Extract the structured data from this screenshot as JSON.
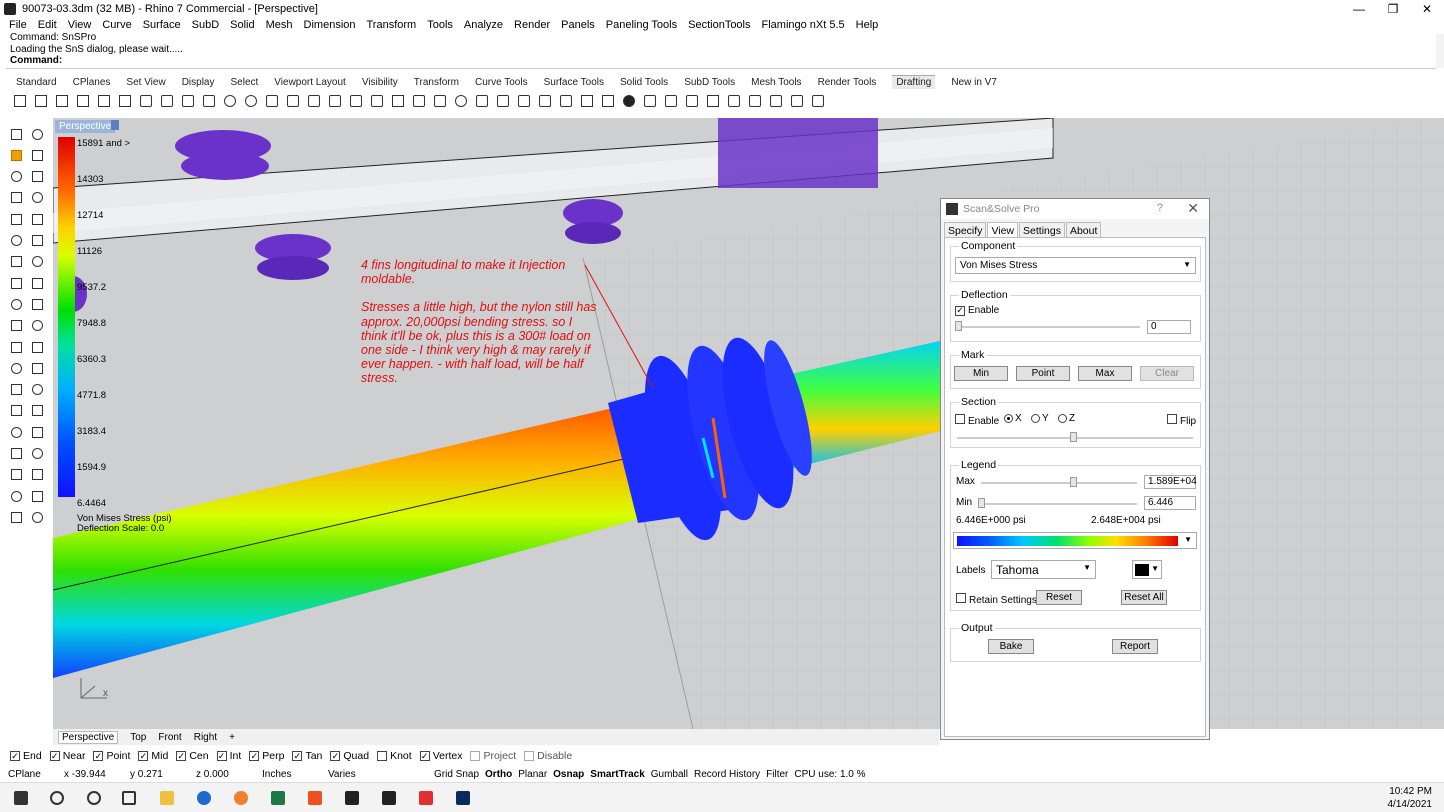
{
  "window": {
    "title": "90073-03.3dm (32 MB) - Rhino 7 Commercial - [Perspective]",
    "minimize": "—",
    "restore": "❐",
    "close": "✕"
  },
  "menu": [
    "File",
    "Edit",
    "View",
    "Curve",
    "Surface",
    "SubD",
    "Solid",
    "Mesh",
    "Dimension",
    "Transform",
    "Tools",
    "Analyze",
    "Render",
    "Panels",
    "Paneling Tools",
    "SectionTools",
    "Flamingo nXt 5.5",
    "Help"
  ],
  "command_history": {
    "line1": "Command: SnSPro",
    "line2": "Loading the SnS dialog, please wait.....",
    "prompt": "Command:"
  },
  "toolbar_tabs": [
    "Standard",
    "CPlanes",
    "Set View",
    "Display",
    "Select",
    "Viewport Layout",
    "Visibility",
    "Transform",
    "Curve Tools",
    "Surface Tools",
    "Solid Tools",
    "SubD Tools",
    "Mesh Tools",
    "Render Tools",
    "Drafting",
    "New in V7"
  ],
  "viewport": {
    "name": "Perspective",
    "legend_values": [
      "15891 and >",
      "14303",
      "12714",
      "11126",
      "9537.2",
      "7948.8",
      "6360.3",
      "4771.8",
      "3183.4",
      "1594.9",
      "6.4464"
    ],
    "legend_title": "Von Mises Stress (psi)",
    "deflection_scale": "Deflection Scale: 0.0",
    "annotation_p1": "4 fins longitudinal to make it Injection moldable.",
    "annotation_p2": "Stresses a little high, but the nylon still has approx. 20,000psi bending stress. so I think it'll be ok, plus this is a 300# load on one side - I think very high & may rarely if ever happen. - with half load, will be half stress.",
    "axis_label": "x"
  },
  "viewport_tabs": [
    "Perspective",
    "Top",
    "Front",
    "Right"
  ],
  "osnaps": [
    {
      "label": "End",
      "checked": true
    },
    {
      "label": "Near",
      "checked": true
    },
    {
      "label": "Point",
      "checked": true
    },
    {
      "label": "Mid",
      "checked": true
    },
    {
      "label": "Cen",
      "checked": true
    },
    {
      "label": "Int",
      "checked": true
    },
    {
      "label": "Perp",
      "checked": true
    },
    {
      "label": "Tan",
      "checked": true
    },
    {
      "label": "Quad",
      "checked": true
    },
    {
      "label": "Knot",
      "checked": false
    },
    {
      "label": "Vertex",
      "checked": true
    },
    {
      "label": "Project",
      "checked": false
    },
    {
      "label": "Disable",
      "checked": false
    }
  ],
  "status": {
    "cplane": "CPlane",
    "x": "x -39.944",
    "y": "y 0.271",
    "z": "z 0.000",
    "units": "Inches",
    "layer": "Varies",
    "grid_snap": "Grid Snap",
    "ortho": "Ortho",
    "planar": "Planar",
    "osnap": "Osnap",
    "smarttrack": "SmartTrack",
    "gumball": "Gumball",
    "record_history": "Record History",
    "filter": "Filter",
    "cpu": "CPU use: 1.0 %"
  },
  "panel": {
    "title": "Scan&Solve Pro",
    "help": "?",
    "close": "✕",
    "tabs": [
      "Specify",
      "View",
      "Settings",
      "About"
    ],
    "component_label": "Component",
    "component_value": "Von Mises Stress",
    "deflection_label": "Deflection",
    "deflection_enable": "Enable",
    "deflection_value": "0",
    "mark_label": "Mark",
    "mark_min": "Min",
    "mark_point": "Point",
    "mark_max": "Max",
    "mark_clear": "Clear",
    "section_label": "Section",
    "section_enable": "Enable",
    "section_x": "X",
    "section_y": "Y",
    "section_z": "Z",
    "section_flip": "Flip",
    "legend_label": "Legend",
    "legend_max_label": "Max",
    "legend_max_value": "1.589E+04",
    "legend_min_label": "Min",
    "legend_min_value": "6.446",
    "range_low": "6.446E+000 psi",
    "range_high": "2.648E+004 psi",
    "labels_label": "Labels",
    "font_value": "Tahoma",
    "retain_settings": "Retain Settings",
    "reset": "Reset",
    "reset_all": "Reset All",
    "output_label": "Output",
    "bake": "Bake",
    "report": "Report"
  },
  "clock": {
    "time": "10:42 PM",
    "date": "4/14/2021"
  },
  "colors": {
    "viewport_bg": "#cdcfd1",
    "annotation": "#e01010",
    "pipe_blue": "#1a2cff",
    "fin_purple": "#6a32c8"
  }
}
